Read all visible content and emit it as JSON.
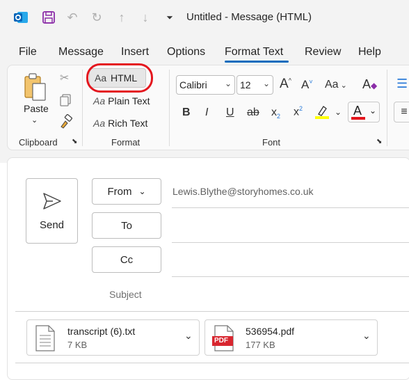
{
  "titlebar": {
    "title": "Untitled  -  Message (HTML)",
    "icons": [
      "outlook-logo-icon",
      "save-icon",
      "undo-icon",
      "redo-icon",
      "up-arrow-icon",
      "down-arrow-icon",
      "customize-qat-icon"
    ]
  },
  "menu": {
    "tabs": [
      "File",
      "Message",
      "Insert",
      "Options",
      "Format Text",
      "Review",
      "Help"
    ],
    "active": "Format Text"
  },
  "ribbon": {
    "clipboard": {
      "paste_label": "Paste",
      "group_label": "Clipboard"
    },
    "format": {
      "html_label": "HTML",
      "plain_label": "Plain Text",
      "rich_label": "Rich Text",
      "aa_glyph": "Aa",
      "group_label": "Format"
    },
    "font": {
      "font_name": "Calibri",
      "font_size": "12",
      "group_label": "Font",
      "bold": "B",
      "italic": "I",
      "underline": "U",
      "strike": "ab",
      "subscript": "x",
      "superscript": "x",
      "grow": "A",
      "shrink": "A",
      "case": "Aa",
      "highlight_color": "#ffff00",
      "font_color": "#e4161e"
    }
  },
  "compose": {
    "send_label": "Send",
    "from_label": "From",
    "from_value": "Lewis.Blythe@storyhomes.co.uk",
    "to_label": "To",
    "cc_label": "Cc",
    "subject_label": "Subject",
    "to_value": "",
    "cc_value": "",
    "subject_value": ""
  },
  "attachments": [
    {
      "name": "transcript (6).txt",
      "size": "7 KB",
      "type": "txt"
    },
    {
      "name": "536954.pdf",
      "size": "177 KB",
      "type": "pdf",
      "badge": "PDF"
    }
  ]
}
